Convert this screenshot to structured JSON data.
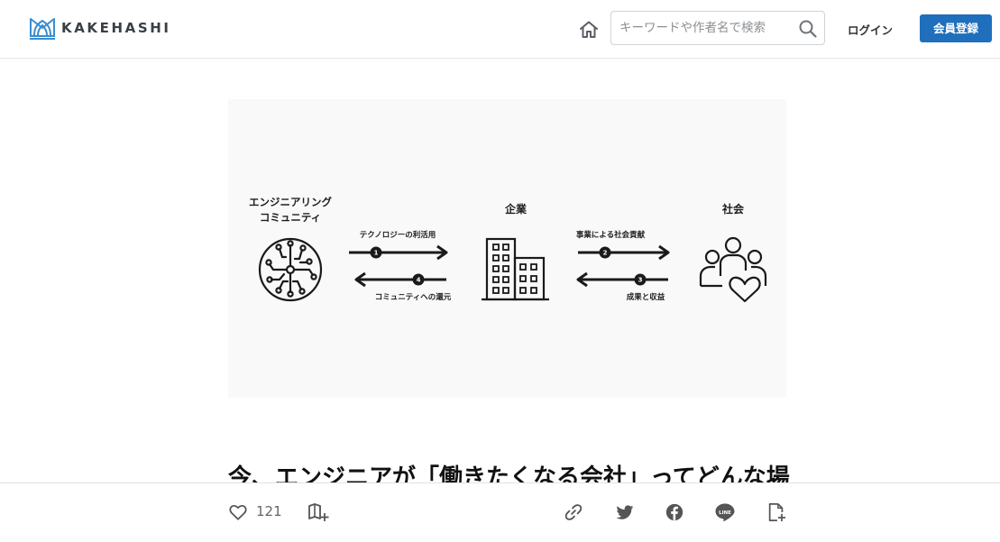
{
  "header": {
    "logo_text": "KAKEHASHI",
    "search_placeholder": "キーワードや作者名で検索",
    "login_label": "ログイン",
    "signup_label": "会員登録"
  },
  "hero": {
    "left_title_line1": "エンジニアリング",
    "left_title_line2": "コミュニティ",
    "center_title": "企業",
    "right_title": "社会",
    "arrow1_label": "テクノロジーの利活用",
    "arrow1_num": "1",
    "arrow4_label": "コミュニティへの還元",
    "arrow4_num": "4",
    "arrow2_label": "事業による社会貢献",
    "arrow2_num": "2",
    "arrow3_label": "成果と収益",
    "arrow3_num": "3"
  },
  "article": {
    "title": "今、エンジニアが「働きたくなる会社」ってどんな場"
  },
  "actions": {
    "like_count": "121"
  },
  "colors": {
    "brand": "#1f6fbd",
    "logo_blue": "#3a8dcf"
  }
}
